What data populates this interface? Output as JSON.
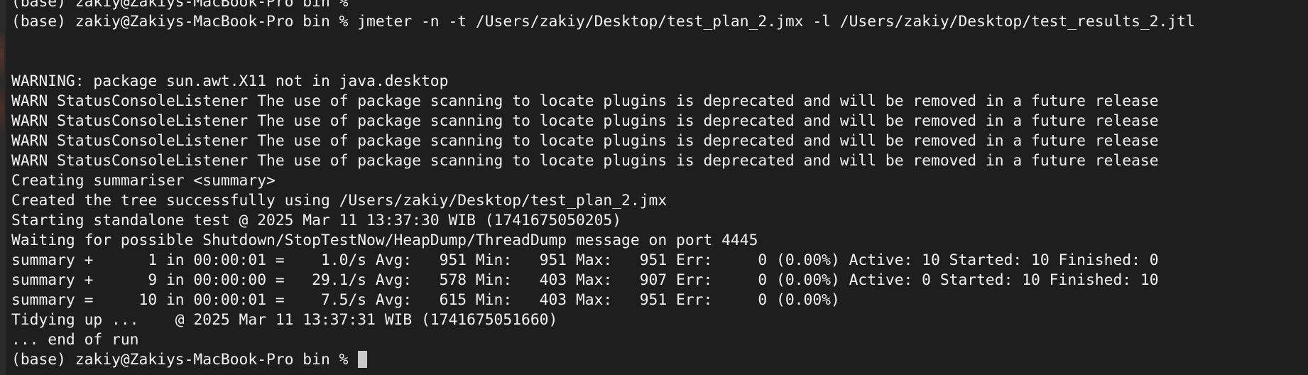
{
  "terminal": {
    "lines": [
      "(base) zakiy@Zakiys-MacBook-Pro bin %",
      "(base) zakiy@Zakiys-MacBook-Pro bin % jmeter -n -t /Users/zakiy/Desktop/test_plan_2.jmx -l /Users/zakiy/Desktop/test_results_2.jtl",
      "",
      "",
      "WARNING: package sun.awt.X11 not in java.desktop",
      "WARN StatusConsoleListener The use of package scanning to locate plugins is deprecated and will be removed in a future release",
      "WARN StatusConsoleListener The use of package scanning to locate plugins is deprecated and will be removed in a future release",
      "WARN StatusConsoleListener The use of package scanning to locate plugins is deprecated and will be removed in a future release",
      "WARN StatusConsoleListener The use of package scanning to locate plugins is deprecated and will be removed in a future release",
      "Creating summariser <summary>",
      "Created the tree successfully using /Users/zakiy/Desktop/test_plan_2.jmx",
      "Starting standalone test @ 2025 Mar 11 13:37:30 WIB (1741675050205)",
      "Waiting for possible Shutdown/StopTestNow/HeapDump/ThreadDump message on port 4445",
      "summary +      1 in 00:00:01 =    1.0/s Avg:   951 Min:   951 Max:   951 Err:     0 (0.00%) Active: 10 Started: 10 Finished: 0",
      "summary +      9 in 00:00:00 =   29.1/s Avg:   578 Min:   403 Max:   907 Err:     0 (0.00%) Active: 0 Started: 10 Finished: 10",
      "summary =     10 in 00:00:01 =    7.5/s Avg:   615 Min:   403 Max:   951 Err:     0 (0.00%)",
      "Tidying up ...    @ 2025 Mar 11 13:37:31 WIB (1741675051660)",
      "... end of run"
    ],
    "prompt": "(base) zakiy@Zakiys-MacBook-Pro bin % "
  }
}
